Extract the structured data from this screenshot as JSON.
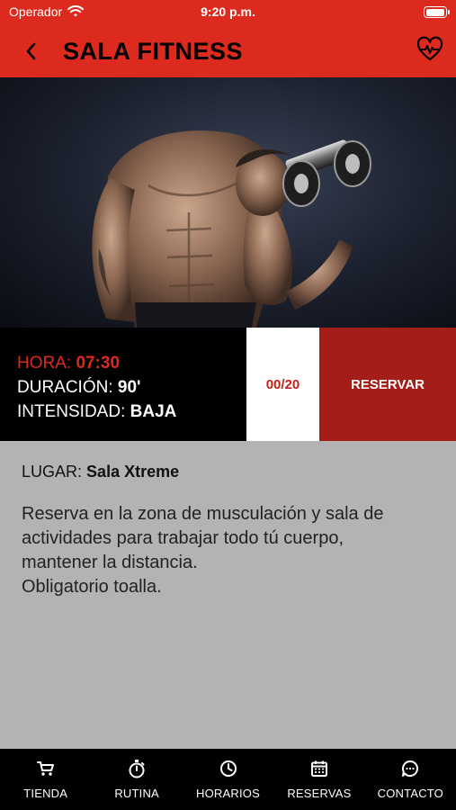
{
  "status": {
    "carrier": "Operador",
    "time": "9:20 p.m.",
    "battery_level": 0.95
  },
  "header": {
    "title": "SALA FITNESS"
  },
  "session": {
    "hora_label": "HORA:",
    "hora_value": "07:30",
    "duracion_label": "DURACIÓN:",
    "duracion_value": "90'",
    "intensidad_label": "INTENSIDAD:",
    "intensidad_value": "BAJA",
    "capacity": "00/20",
    "reserve_label": "RESERVAR"
  },
  "details": {
    "lugar_label": "LUGAR:",
    "lugar_value": "Sala Xtreme",
    "description": "Reserva en la zona de musculación y sala de\nactividades para trabajar todo tú cuerpo,\nmantener la distancia.\nObligatorio toalla."
  },
  "tabs": [
    {
      "label": "TIENDA",
      "icon": "cart-icon"
    },
    {
      "label": "RUTINA",
      "icon": "stopwatch-icon"
    },
    {
      "label": "HORARIOS",
      "icon": "clock-icon"
    },
    {
      "label": "RESERVAS",
      "icon": "calendar-icon"
    },
    {
      "label": "CONTACTO",
      "icon": "chat-icon"
    }
  ],
  "colors": {
    "brand_red": "#dd2a1e",
    "dark_red": "#a31d19",
    "panel_gray": "#b3b3b3"
  }
}
